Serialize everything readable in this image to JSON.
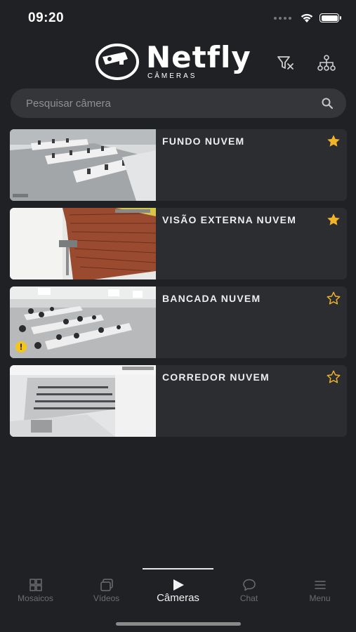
{
  "status": {
    "time": "09:20"
  },
  "brand": {
    "name": "Netfly",
    "sub": "CÂMERAS"
  },
  "search": {
    "placeholder": "Pesquisar câmera",
    "value": ""
  },
  "cameras": [
    {
      "title": "FUNDO NUVEM",
      "favorite": true,
      "warning": false
    },
    {
      "title": "VISÃO EXTERNA NUVEM",
      "favorite": true,
      "warning": false
    },
    {
      "title": "BANCADA NUVEM",
      "favorite": false,
      "warning": true
    },
    {
      "title": "CORREDOR NUVEM",
      "favorite": false,
      "warning": false
    }
  ],
  "tabs": [
    {
      "label": "Mosaicos",
      "icon": "grid-icon"
    },
    {
      "label": "Vídeos",
      "icon": "videos-icon"
    },
    {
      "label": "Câmeras",
      "icon": "play-icon",
      "active": true
    },
    {
      "label": "Chat",
      "icon": "chat-icon"
    },
    {
      "label": "Menu",
      "icon": "menu-icon"
    }
  ],
  "colors": {
    "accent": "#f0b429",
    "background": "#202124",
    "card": "#2c2d31"
  }
}
